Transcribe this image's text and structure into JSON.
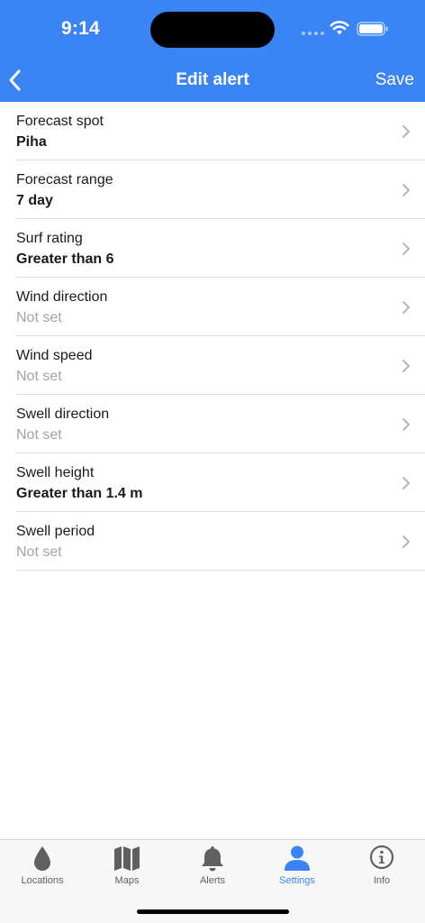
{
  "status_bar": {
    "time": "9:14"
  },
  "nav": {
    "title": "Edit alert",
    "save_label": "Save"
  },
  "rows": [
    {
      "label": "Forecast spot",
      "value": "Piha",
      "is_set": true
    },
    {
      "label": "Forecast range",
      "value": "7 day",
      "is_set": true
    },
    {
      "label": "Surf rating",
      "value": "Greater than 6",
      "is_set": true
    },
    {
      "label": "Wind direction",
      "value": "Not set",
      "is_set": false
    },
    {
      "label": "Wind speed",
      "value": "Not set",
      "is_set": false
    },
    {
      "label": "Swell direction",
      "value": "Not set",
      "is_set": false
    },
    {
      "label": "Swell height",
      "value": "Greater than 1.4 m",
      "is_set": true
    },
    {
      "label": "Swell period",
      "value": "Not set",
      "is_set": false
    }
  ],
  "tabs": [
    {
      "label": "Locations",
      "icon": "drop-icon",
      "active": false
    },
    {
      "label": "Maps",
      "icon": "map-icon",
      "active": false
    },
    {
      "label": "Alerts",
      "icon": "bell-icon",
      "active": false
    },
    {
      "label": "Settings",
      "icon": "person-icon",
      "active": true
    },
    {
      "label": "Info",
      "icon": "info-icon",
      "active": false
    }
  ],
  "colors": {
    "accent": "#3a84f5",
    "unset_text": "#a3a3a3",
    "tab_inactive": "#606060"
  }
}
